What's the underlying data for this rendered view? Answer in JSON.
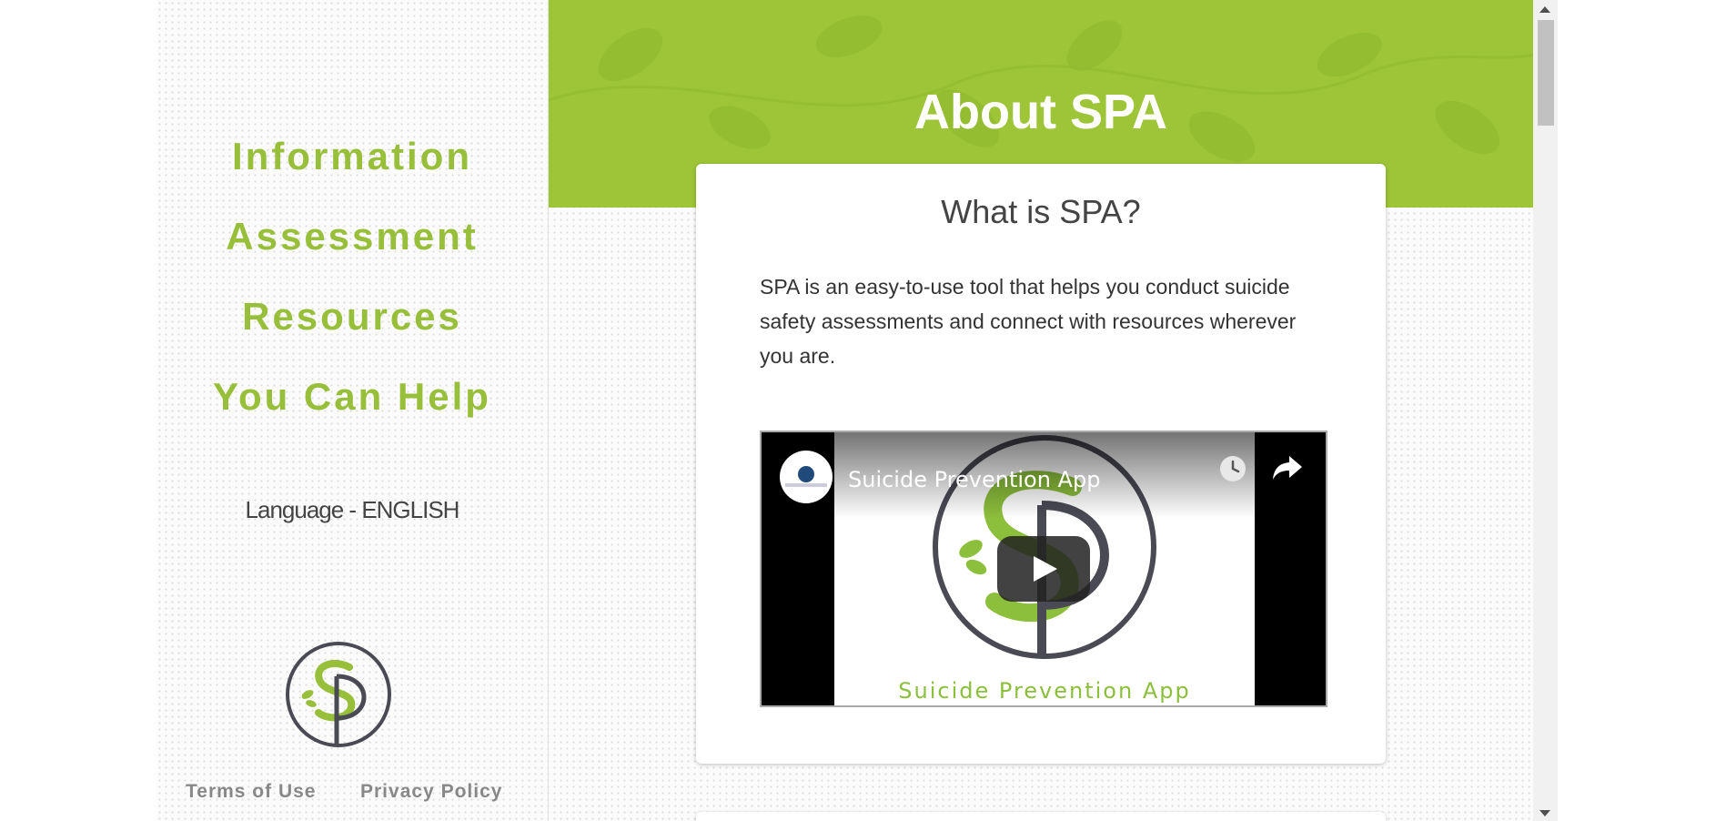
{
  "sidebar": {
    "nav": [
      {
        "label": "Information"
      },
      {
        "label": "Assessment"
      },
      {
        "label": "Resources"
      },
      {
        "label": "You Can Help"
      }
    ],
    "language_label": "Language - ENGLISH",
    "footer": {
      "terms_label": "Terms of Use",
      "privacy_label": "Privacy Policy"
    }
  },
  "banner": {
    "title": "About SPA"
  },
  "card": {
    "title": "What is SPA?",
    "text": "SPA is an easy-to-use tool that helps you conduct suicide safety assessments and connect with resources wherever you are.",
    "video": {
      "title": "Suicide Prevention App",
      "caption": "Suicide Prevention App",
      "channel_icon": "channel-avatar-icon"
    }
  },
  "colors": {
    "brand_green": "#9dc537",
    "nav_green": "#97bf3a",
    "dark_gray": "#4a4a55"
  }
}
